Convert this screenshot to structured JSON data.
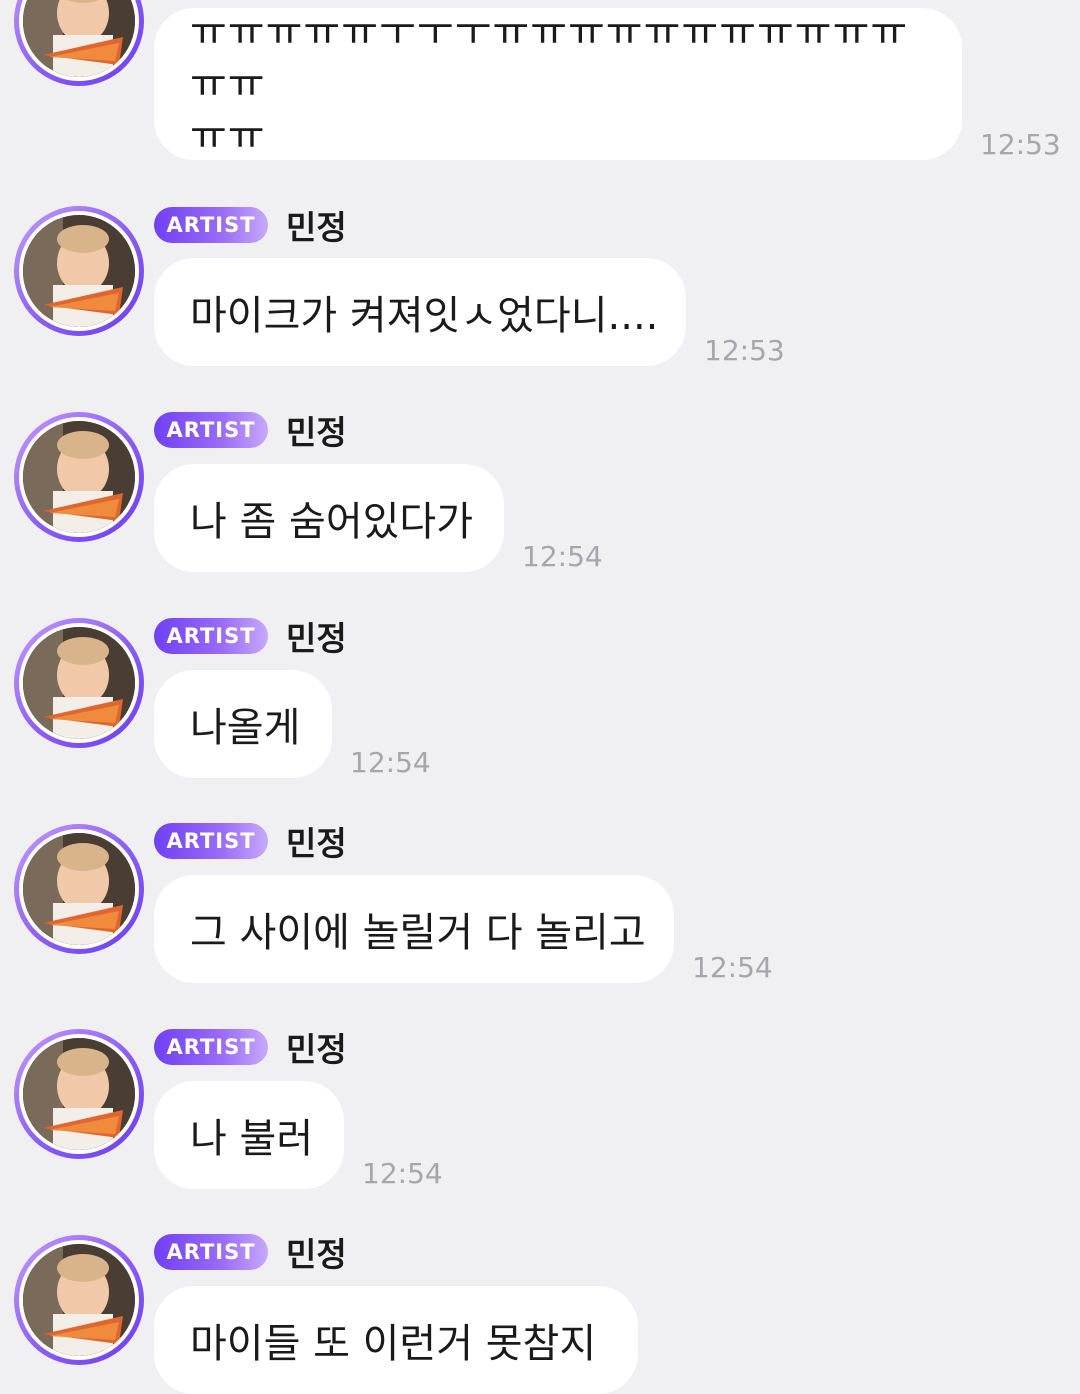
{
  "colors": {
    "background": "#f0f0f2",
    "bubble": "#ffffff",
    "badge_start": "#6f40f2",
    "badge_end": "#c6a9fb",
    "time_text": "#a6a6ab",
    "avatar_ring": "#8a5cf6"
  },
  "messages": [
    {
      "show_header": false,
      "lines": [
        "ㅠㅠㅠㅠㅠㅜㅜㅜㅠㅠㅠㅠㅠㅠㅠㅠㅠㅠㅠㅠㅠ",
        "ㅠㅠ"
      ],
      "time": "12:53"
    },
    {
      "show_header": true,
      "badge": "ARTIST",
      "sender": "민정",
      "text": "마이크가 켜져잇ㅅ었다니....",
      "time": "12:53"
    },
    {
      "show_header": true,
      "badge": "ARTIST",
      "sender": "민정",
      "text": "나 좀 숨어있다가",
      "time": "12:54"
    },
    {
      "show_header": true,
      "badge": "ARTIST",
      "sender": "민정",
      "text": "나올게",
      "time": "12:54"
    },
    {
      "show_header": true,
      "badge": "ARTIST",
      "sender": "민정",
      "text": "그 사이에 놀릴거 다 놀리고",
      "time": "12:54"
    },
    {
      "show_header": true,
      "badge": "ARTIST",
      "sender": "민정",
      "text": "나 불러",
      "time": "12:54"
    },
    {
      "show_header": true,
      "badge": "ARTIST",
      "sender": "민정",
      "text": "마이들 또 이런거 못참지",
      "time": ""
    }
  ]
}
